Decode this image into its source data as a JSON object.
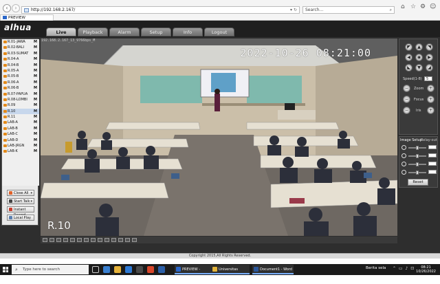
{
  "browser": {
    "url": "http://192.168.2.167/",
    "search_placeholder": "Search...",
    "tab_title": "PREVIEW"
  },
  "app": {
    "logo": "alhua",
    "nav": [
      {
        "label": "Live",
        "active": true
      },
      {
        "label": "Playback"
      },
      {
        "label": "Alarm"
      },
      {
        "label": "Setup"
      },
      {
        "label": "Info"
      },
      {
        "label": "Logout"
      }
    ],
    "cameras": [
      "R.01-JAWA",
      "R.02-BALI",
      "R.03-SUMAT",
      "R.04-A",
      "R.04-B",
      "R.05-A",
      "R.05-B",
      "R.06-A",
      "R.06-B",
      "R.07-PAPUA",
      "R.08-LOMBI",
      "R.09",
      "R.10",
      "R.11",
      "LAB-A",
      "LAB-B",
      "LAB-C",
      "LAB-D",
      "LAB-JRGN",
      "LAB-K"
    ],
    "cam_marker": "M",
    "controls": {
      "close_all": "Close All",
      "start_talk": "Start Talk",
      "instant_record": "Instant Record",
      "local_play": "Local Play"
    },
    "video": {
      "stream_info": "192.168.2.167_13_9766bps_M",
      "timestamp": "2022-10-26 08:21:00",
      "room_label": "R.10"
    },
    "ptz": {
      "speed_label": "Speed(1-8)",
      "speed_value": "5",
      "zoom": "Zoom",
      "focus": "Focus",
      "iris": "Iris"
    },
    "image_setup": {
      "title": "Image Setup",
      "relay": "Relay-out",
      "reset": "Reset"
    },
    "footer": "Copyright 2015,All Rights Reserved."
  },
  "taskbar": {
    "search_placeholder": "Type here to search",
    "tasks": [
      {
        "label": "PREVIEW - Internet ...",
        "color": "#2a66c8"
      },
      {
        "label": "Universitas Bakrie - ...",
        "color": "#e2b33a"
      },
      {
        "label": "Document1 - Word",
        "color": "#2b579a"
      }
    ],
    "weather": "Berita sela",
    "time": "08:21",
    "date": "10/26/2022"
  }
}
